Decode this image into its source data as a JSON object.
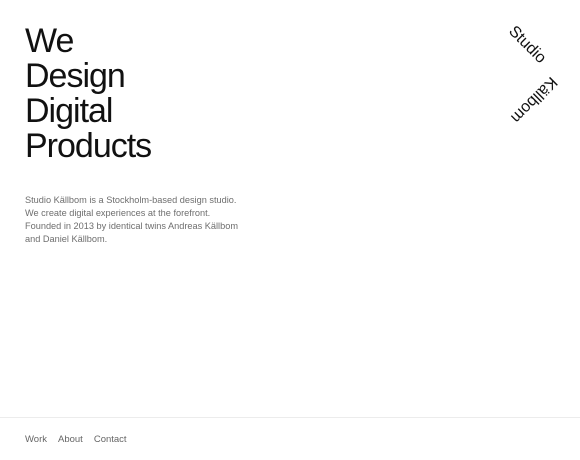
{
  "hero": {
    "headline_lines": [
      "We",
      "Design",
      "Digital",
      "Products"
    ]
  },
  "intro": {
    "lines": [
      "Studio Källbom is a Stockholm-based design studio.",
      "We create digital experiences at the forefront.",
      "Founded in 2013 by identical twins Andreas Källbom",
      "and Daniel Källbom."
    ]
  },
  "logo": {
    "word1": "Studio",
    "word2": "Källbom"
  },
  "footer": {
    "nav": [
      "Work",
      "About",
      "Contact"
    ]
  }
}
